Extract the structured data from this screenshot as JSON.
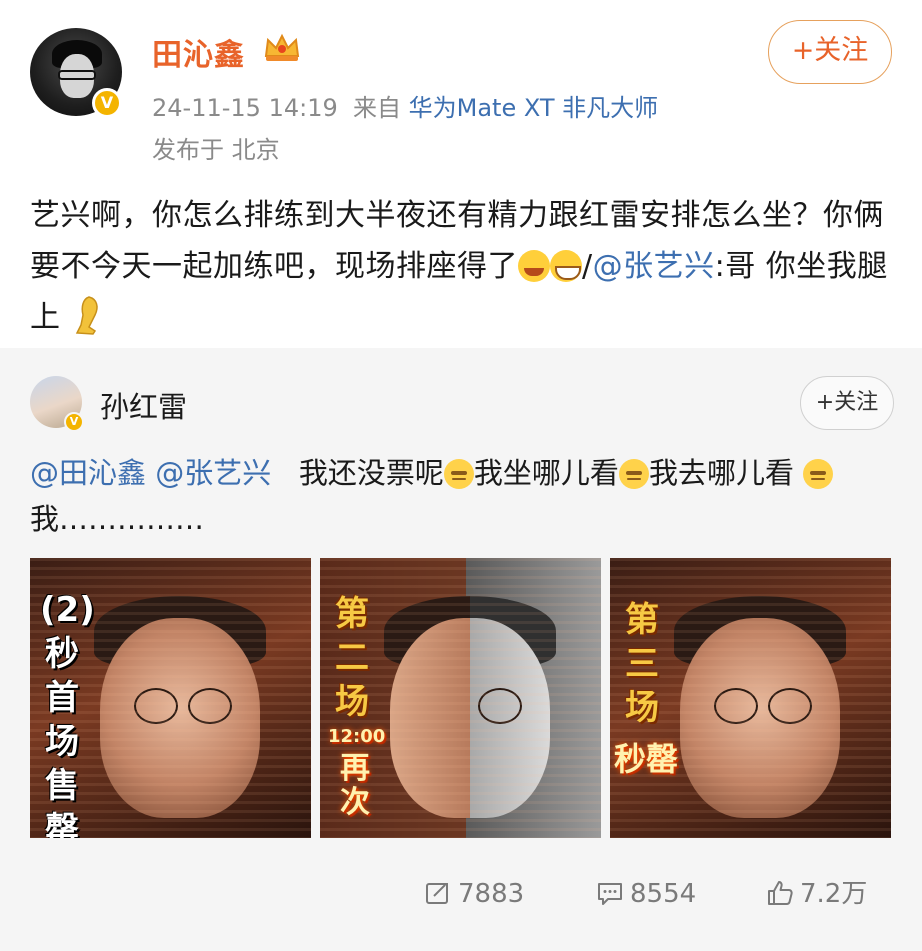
{
  "author": {
    "name": "田沁鑫",
    "verified_badge": "V",
    "follow_label": "+关注",
    "timestamp": "24-11-15 14:19",
    "source_prefix": "来自",
    "device": "华为Mate XT 非凡大师",
    "location": "发布于 北京"
  },
  "post": {
    "text_1": "艺兴啊，你怎么排练到大半夜还有精力跟红雷安排怎么坐？你俩要不今天一起加练吧，现场排座得了",
    "slash": "/",
    "mention": "@张艺兴",
    "text_2": ":哥 你坐我腿上",
    "emojis": [
      "laugh-cry-emoji",
      "grin-emoji",
      "leg-emoji"
    ]
  },
  "repost": {
    "author_name": "孙红雷",
    "verified_badge": "V",
    "follow_label": "+关注",
    "mention_1": "@田沁鑫",
    "mention_2": "@张艺兴",
    "text_1": "我还没票呢",
    "text_2": "我坐哪儿看",
    "text_3": "我去哪儿看",
    "text_4": "我……………",
    "images": [
      {
        "caption_chars": [
          "(2)",
          "秒",
          "首",
          "场",
          "售",
          "罄"
        ]
      },
      {
        "caption_chars": [
          "第",
          "二",
          "场"
        ],
        "flame_time": "12:00",
        "flame_text": [
          "再",
          "次"
        ]
      },
      {
        "caption_chars": [
          "第",
          "三",
          "场"
        ],
        "flame_text": [
          "秒",
          "罄"
        ]
      }
    ]
  },
  "stats": {
    "reposts": "7883",
    "comments": "8554",
    "likes": "7.2万"
  },
  "colors": {
    "username": "#e8632a",
    "link": "#3d6fb0",
    "muted": "#8a8a8a",
    "verified": "#f4b400"
  }
}
